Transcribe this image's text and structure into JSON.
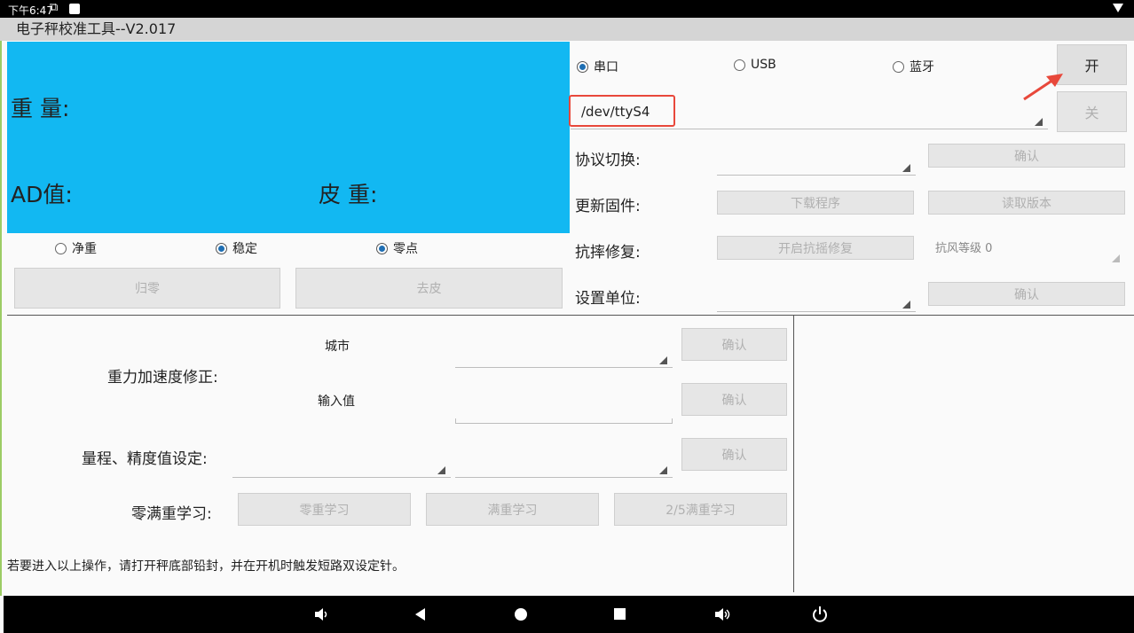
{
  "status": {
    "time": "下午6:47",
    "sim_icon": "⧉"
  },
  "app": {
    "title": "电子秤校准工具--V2.017"
  },
  "display": {
    "weight_label": "重 量:",
    "ad_label": "AD值:",
    "tare_label": "皮 重:"
  },
  "indicators": [
    {
      "label": "净重",
      "checked": false
    },
    {
      "label": "稳定",
      "checked": true
    },
    {
      "label": "零点",
      "checked": true
    }
  ],
  "buttons": {
    "zero": "归零",
    "tare": "去皮",
    "open": "开",
    "close": "关",
    "confirm": "确认",
    "download": "下载程序",
    "read_version": "读取版本",
    "anti_shake": "开启抗摇修复",
    "zero_learn": "零重学习",
    "full_learn": "满重学习",
    "two_fifth_learn": "2/5满重学习"
  },
  "connection": {
    "options": [
      "串口",
      "USB",
      "蓝牙"
    ],
    "selected": "串口",
    "port": "/dev/ttyS4"
  },
  "settings": {
    "protocol_label": "协议切换:",
    "firmware_label": "更新固件:",
    "anti_shake_label": "抗摔修复:",
    "wind_level": "抗风等级 0",
    "unit_label": "设置单位:"
  },
  "gravity": {
    "label": "重力加速度修正:",
    "city_label": "城市",
    "input_label": "输入值"
  },
  "range": {
    "label": "量程、精度值设定:"
  },
  "learn": {
    "label": "零满重学习:"
  },
  "notice": "若要进入以上操作，请打开秤底部铅封，并在开机时触发短路双设定针。",
  "colors": {
    "panel": "#12b8f2",
    "highlight": "#e8483b",
    "arrow": "#e8483b"
  }
}
